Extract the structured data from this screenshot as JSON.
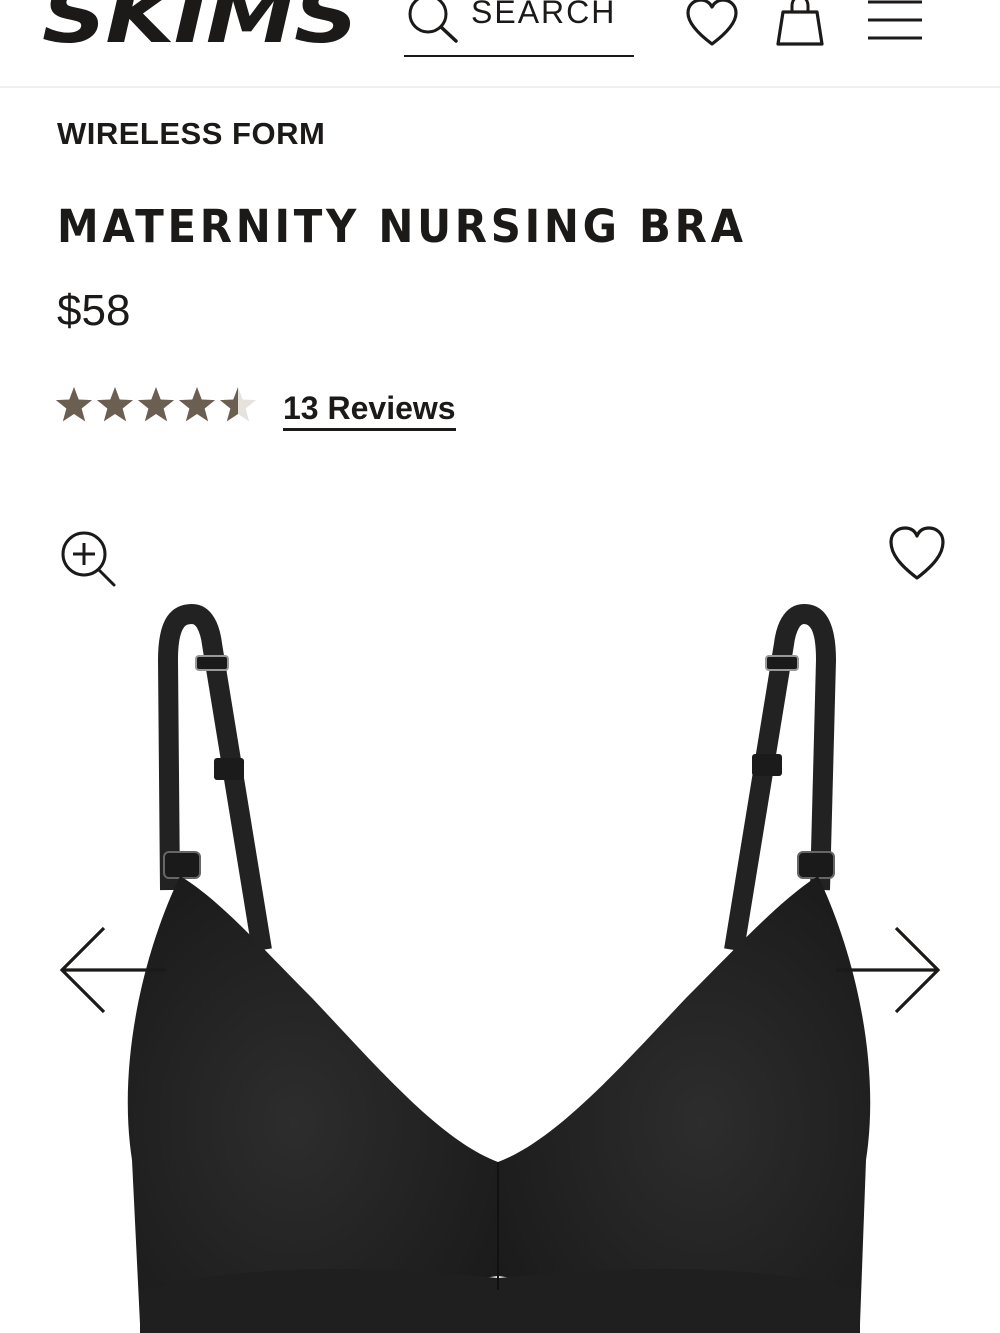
{
  "header": {
    "logo_text": "SKIMS",
    "search_label": "SEARCH"
  },
  "product": {
    "collection": "WIRELESS FORM",
    "title": "MATERNITY NURSING BRA",
    "price": "$58",
    "rating_value": 4.5,
    "rating_max": 5,
    "reviews_label": "13 Reviews",
    "star_color": "#6b5f51",
    "image_color": "#232323"
  },
  "icons": {
    "search": "search-icon",
    "header_wishlist": "heart-icon",
    "bag": "shopping-bag-icon",
    "menu": "hamburger-menu-icon",
    "zoom": "zoom-in-icon",
    "image_wishlist": "heart-icon",
    "prev": "arrow-left-icon",
    "next": "arrow-right-icon"
  }
}
